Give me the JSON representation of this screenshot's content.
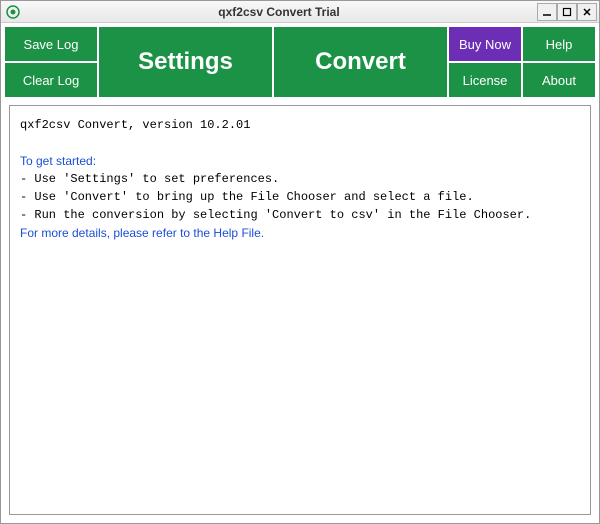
{
  "window": {
    "title": "qxf2csv Convert Trial"
  },
  "toolbar": {
    "save_log": "Save Log",
    "clear_log": "Clear Log",
    "settings": "Settings",
    "convert": "Convert",
    "buy_now": "Buy Now",
    "license": "License",
    "help": "Help",
    "about": "About"
  },
  "log": {
    "version_line": "qxf2csv Convert, version 10.2.01",
    "get_started_header": "To get started:",
    "line1": "- Use 'Settings' to set preferences.",
    "line2": "- Use 'Convert' to bring up the File Chooser and select a file.",
    "line3": "- Run the conversion by selecting 'Convert to csv' in the File Chooser.",
    "details_line": "For more details, please refer to the Help File."
  }
}
